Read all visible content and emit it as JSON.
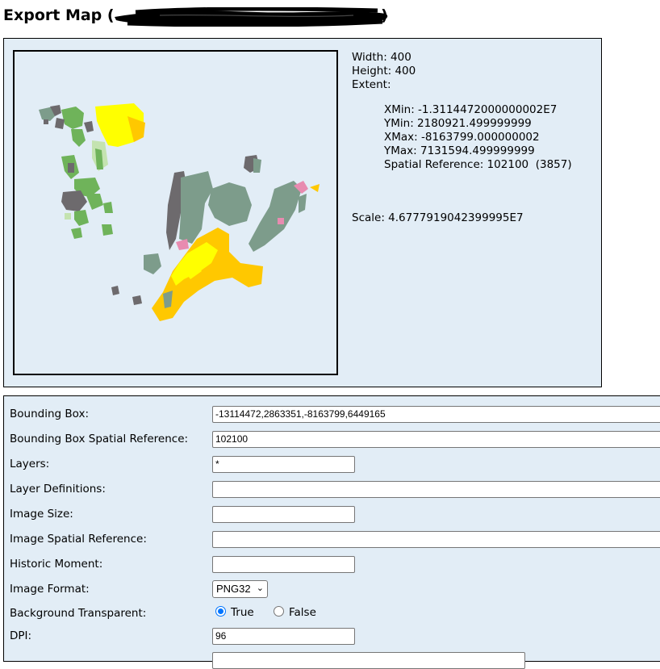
{
  "page": {
    "title": "Export Map (",
    "title_close": ")"
  },
  "map_info": {
    "width": "Width: 400",
    "height": "Height: 400",
    "extent_label": "Extent:",
    "xmin": "XMin: -1.3114472000000002E7",
    "ymin": "YMin: 2180921.499999999",
    "xmax": "XMax: -8163799.000000002",
    "ymax": "YMax: 7131594.499999999",
    "spatial_reference": "Spatial Reference: 102100  (3857)",
    "scale": "Scale: 4.6777919042399995E7"
  },
  "form": {
    "bbox_label": "Bounding Box:",
    "bbox_value": "-13114472,2863351,-8163799,6449165",
    "bbox_sr_label": "Bounding Box Spatial Reference:",
    "bbox_sr_value": "102100",
    "layers_label": "Layers:",
    "layers_value": "*",
    "layer_defs_label": "Layer Definitions:",
    "layer_defs_value": "",
    "image_size_label": "Image Size:",
    "image_size_value": "",
    "image_sr_label": "Image Spatial Reference:",
    "image_sr_value": "",
    "historic_label": "Historic Moment:",
    "historic_value": "",
    "format_label": "Image Format:",
    "format_value": "PNG32",
    "transparent_label": "Background Transparent:",
    "transparent_true": "True",
    "transparent_false": "False",
    "dpi_label": "DPI:",
    "dpi_value": "96"
  },
  "colors": {
    "panel_bg": "#e2edf6",
    "yellow": "#ffff00",
    "orange_yellow": "#ffc800",
    "green": "#6fb35a",
    "light_green": "#c4e3b0",
    "gray_green": "#7d9c8b",
    "dark_gray": "#6d6a6d",
    "pink": "#e88bb0",
    "radio_accent": "#0075ff"
  }
}
